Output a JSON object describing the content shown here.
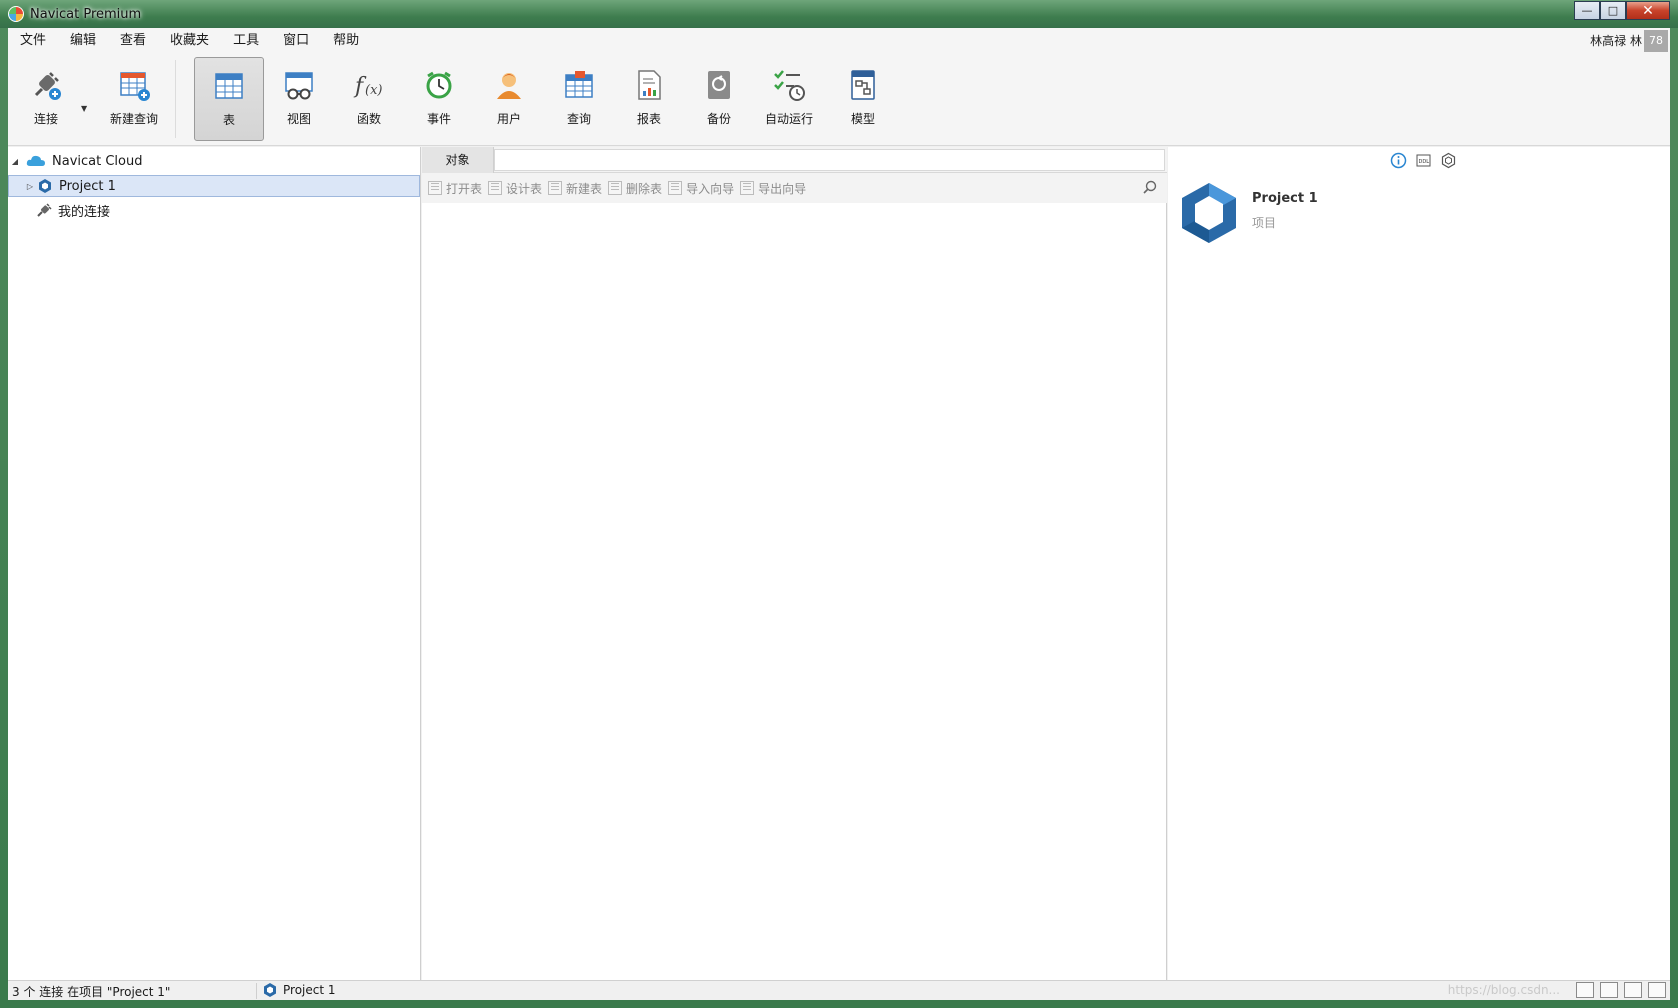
{
  "window": {
    "title": "Navicat Premium",
    "close": "✕",
    "maximize": "□",
    "minimize": "—"
  },
  "menu": {
    "items": [
      "文件",
      "编辑",
      "查看",
      "收藏夹",
      "工具",
      "窗口",
      "帮助"
    ],
    "user": "林高禄 林",
    "badge": "78"
  },
  "toolbar": {
    "connect": "连接",
    "new_query": "新建查询",
    "table": "表",
    "view": "视图",
    "function": "函数",
    "event": "事件",
    "user": "用户",
    "query": "查询",
    "report": "报表",
    "backup": "备份",
    "autorun": "自动运行",
    "model": "模型"
  },
  "nav": {
    "cloud": "Navicat Cloud",
    "project": "Project 1",
    "my_connections": "我的连接"
  },
  "objects": {
    "tab": "对象",
    "actions": [
      "打开表",
      "设计表",
      "新建表",
      "删除表",
      "导入向导",
      "导出向导"
    ]
  },
  "info": {
    "title": "Project 1",
    "subtitle": "项目"
  },
  "status": {
    "left": "3 个 连接 在项目 \"Project 1\"",
    "project": "Project 1",
    "watermark": "https://blog.csdn..."
  },
  "colors": {
    "accent": "#3a8fd6",
    "selection": "#dbe6f7",
    "hex_dark": "#2a6aa8",
    "hex_light": "#5fb0ec"
  }
}
